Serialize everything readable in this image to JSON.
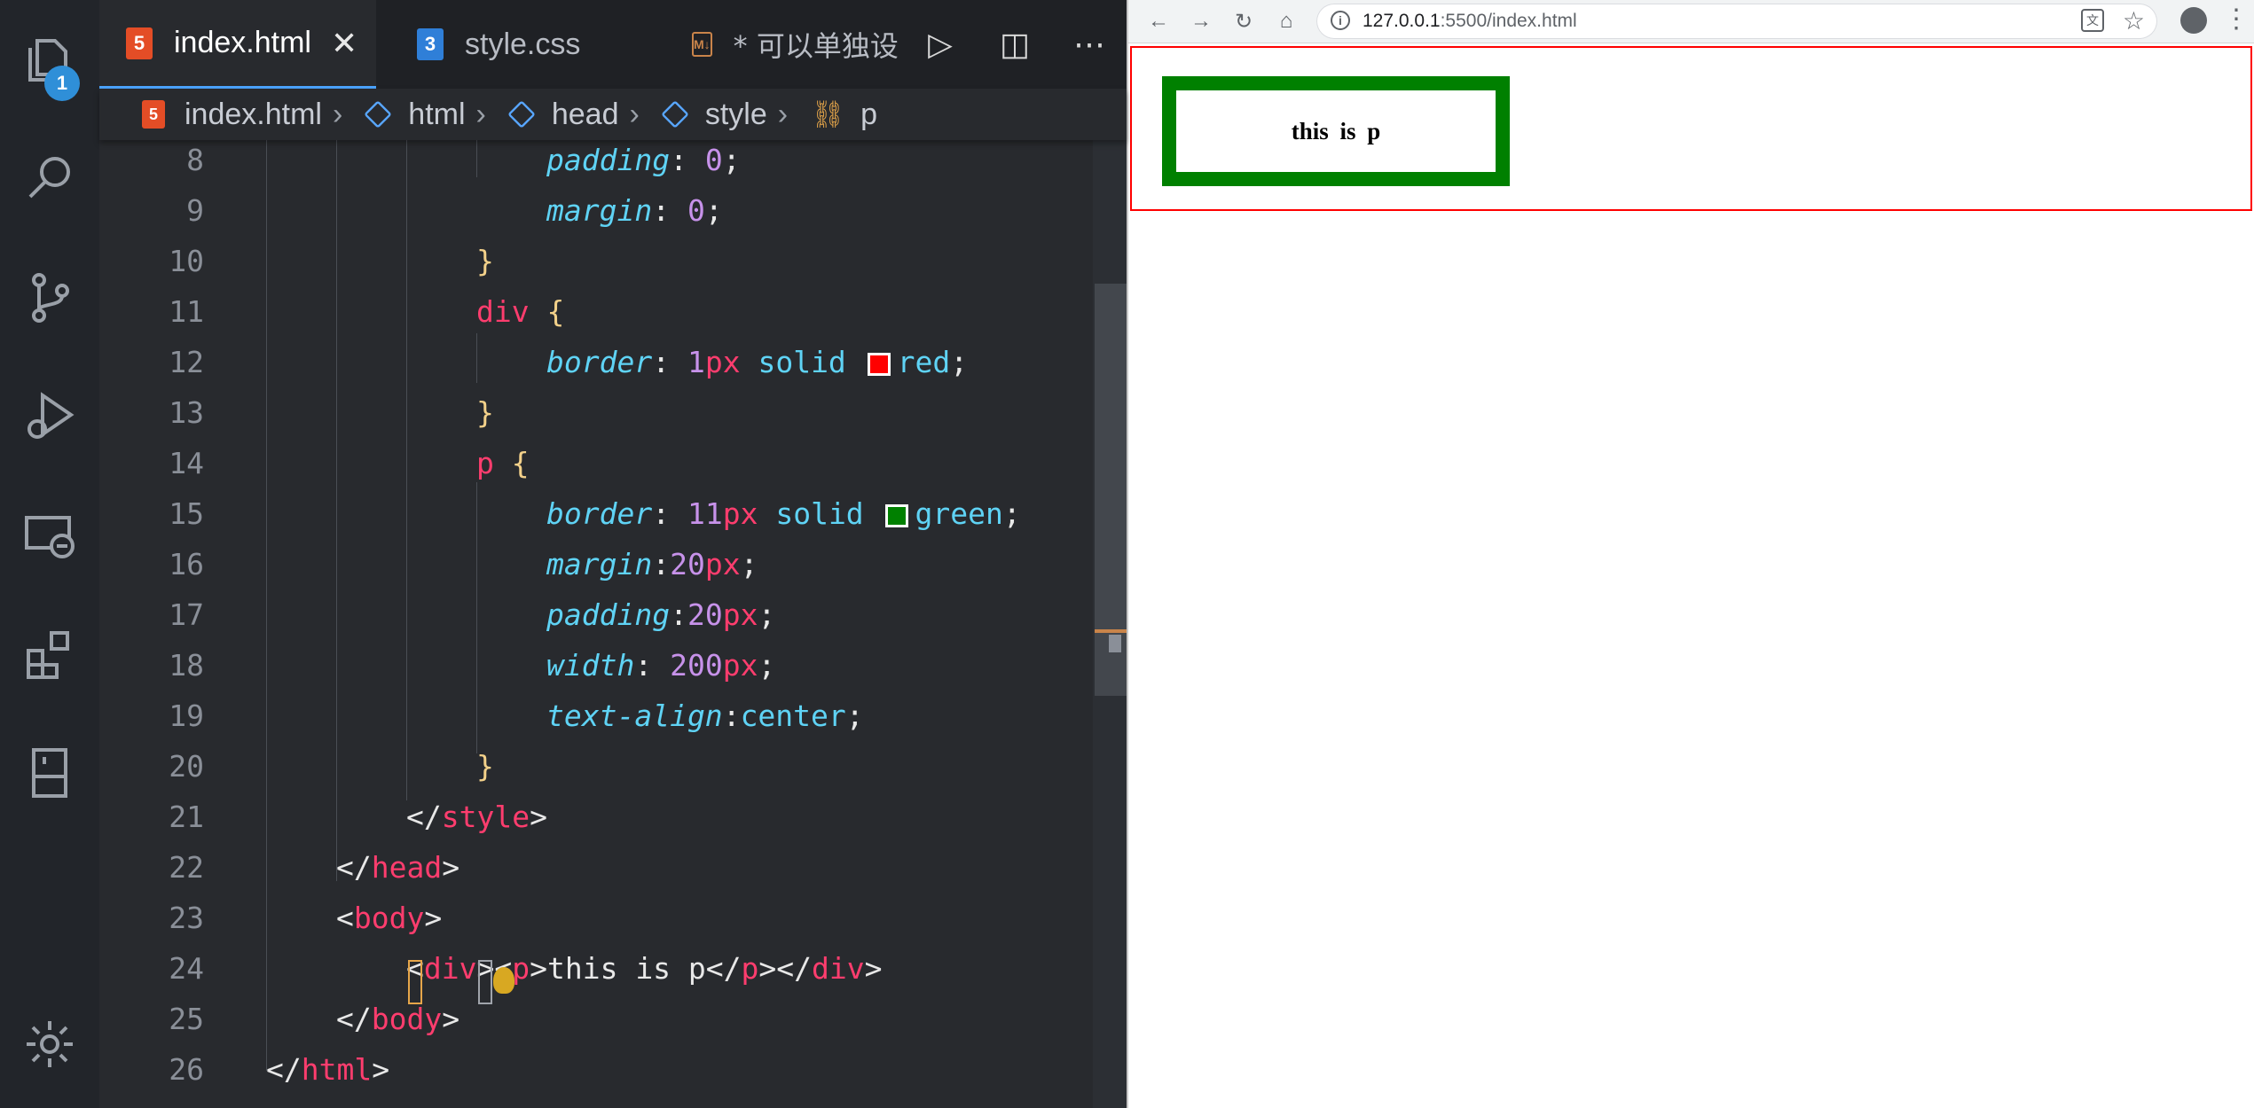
{
  "editor": {
    "tabs": [
      {
        "label": "index.html",
        "icon": "html5-icon",
        "active": true
      },
      {
        "label": "style.css",
        "icon": "css3-icon",
        "active": false
      },
      {
        "label": "* 可以单独设",
        "icon": "markdown-icon",
        "active": false
      }
    ],
    "breadcrumb": [
      "index.html",
      "html",
      "head",
      "style",
      "p"
    ],
    "explorer_badge": "1",
    "lines": [
      {
        "n": "8",
        "indent": 3,
        "tokens": [
          [
            "prop",
            "padding"
          ],
          [
            "punc",
            ": "
          ],
          [
            "num",
            "0"
          ],
          [
            "punc",
            ";"
          ]
        ]
      },
      {
        "n": "9",
        "indent": 3,
        "tokens": [
          [
            "prop",
            "margin"
          ],
          [
            "punc",
            ": "
          ],
          [
            "num",
            "0"
          ],
          [
            "punc",
            ";"
          ]
        ]
      },
      {
        "n": "10",
        "indent": 2,
        "tokens": [
          [
            "brace",
            "}"
          ]
        ]
      },
      {
        "n": "11",
        "indent": 2,
        "tokens": [
          [
            "tag",
            "div"
          ],
          [
            "punc",
            " "
          ],
          [
            "brace",
            "{"
          ]
        ]
      },
      {
        "n": "12",
        "indent": 3,
        "tokens": [
          [
            "prop",
            "border"
          ],
          [
            "punc",
            ": "
          ],
          [
            "num",
            "1"
          ],
          [
            "unit",
            "px"
          ],
          [
            "val",
            " solid "
          ],
          [
            "swatch",
            "#ff0000"
          ],
          [
            "val",
            "red"
          ],
          [
            "punc",
            ";"
          ]
        ]
      },
      {
        "n": "13",
        "indent": 2,
        "tokens": [
          [
            "brace",
            "}"
          ]
        ]
      },
      {
        "n": "14",
        "indent": 2,
        "tokens": [
          [
            "tag",
            "p"
          ],
          [
            "punc",
            " "
          ],
          [
            "brace",
            "{"
          ]
        ]
      },
      {
        "n": "15",
        "indent": 3,
        "tokens": [
          [
            "prop",
            "border"
          ],
          [
            "punc",
            ": "
          ],
          [
            "num",
            "11"
          ],
          [
            "unit",
            "px"
          ],
          [
            "val",
            " solid "
          ],
          [
            "swatch",
            "#008000"
          ],
          [
            "val",
            "green"
          ],
          [
            "punc",
            ";"
          ]
        ]
      },
      {
        "n": "16",
        "indent": 3,
        "tokens": [
          [
            "prop",
            "margin"
          ],
          [
            "punc",
            ":"
          ],
          [
            "num",
            "20"
          ],
          [
            "unit",
            "px"
          ],
          [
            "punc",
            ";"
          ]
        ]
      },
      {
        "n": "17",
        "indent": 3,
        "tokens": [
          [
            "prop",
            "padding"
          ],
          [
            "punc",
            ":"
          ],
          [
            "num",
            "20"
          ],
          [
            "unit",
            "px"
          ],
          [
            "punc",
            ";"
          ]
        ]
      },
      {
        "n": "18",
        "indent": 3,
        "tokens": [
          [
            "prop",
            "width"
          ],
          [
            "punc",
            ": "
          ],
          [
            "num",
            "200"
          ],
          [
            "unit",
            "px"
          ],
          [
            "punc",
            ";"
          ]
        ]
      },
      {
        "n": "19",
        "indent": 3,
        "tokens": [
          [
            "prop",
            "text-align"
          ],
          [
            "punc",
            ":"
          ],
          [
            "val",
            "center"
          ],
          [
            "punc",
            ";"
          ]
        ]
      },
      {
        "n": "20",
        "indent": 2,
        "tokens": [
          [
            "brace",
            "}"
          ]
        ]
      },
      {
        "n": "21",
        "indent": 1,
        "tokens": [
          [
            "punc",
            "</"
          ],
          [
            "tag",
            "style"
          ],
          [
            "punc",
            ">"
          ]
        ]
      },
      {
        "n": "22",
        "indent": 0,
        "tokens": [
          [
            "punc",
            "</"
          ],
          [
            "tag",
            "head"
          ],
          [
            "punc",
            ">"
          ]
        ]
      },
      {
        "n": "23",
        "indent": 0,
        "tokens": [
          [
            "punc",
            "<"
          ],
          [
            "tag",
            "body"
          ],
          [
            "punc",
            ">"
          ]
        ]
      },
      {
        "n": "24",
        "indent": 1,
        "tokens": [
          [
            "punc",
            "<"
          ],
          [
            "tag",
            "div"
          ],
          [
            "punc",
            "><"
          ],
          [
            "tag",
            "p"
          ],
          [
            "punc",
            ">this is p</"
          ],
          [
            "tag",
            "p"
          ],
          [
            "punc",
            "></"
          ],
          [
            "tag",
            "div"
          ],
          [
            "punc",
            ">"
          ]
        ]
      },
      {
        "n": "25",
        "indent": 0,
        "tokens": [
          [
            "punc",
            "</"
          ],
          [
            "tag",
            "body"
          ],
          [
            "punc",
            ">"
          ]
        ]
      },
      {
        "n": "26",
        "indent": -1,
        "tokens": [
          [
            "punc",
            "</"
          ],
          [
            "tag",
            "html"
          ],
          [
            "punc",
            ">"
          ]
        ]
      }
    ]
  },
  "browser": {
    "url_host": "127.0.0.1",
    "url_rest": ":5500/index.html",
    "paragraph_text": "this is p"
  },
  "colors": {
    "accent": "#4ba3ff",
    "div_border": "#ff0000",
    "p_border": "#008000"
  }
}
